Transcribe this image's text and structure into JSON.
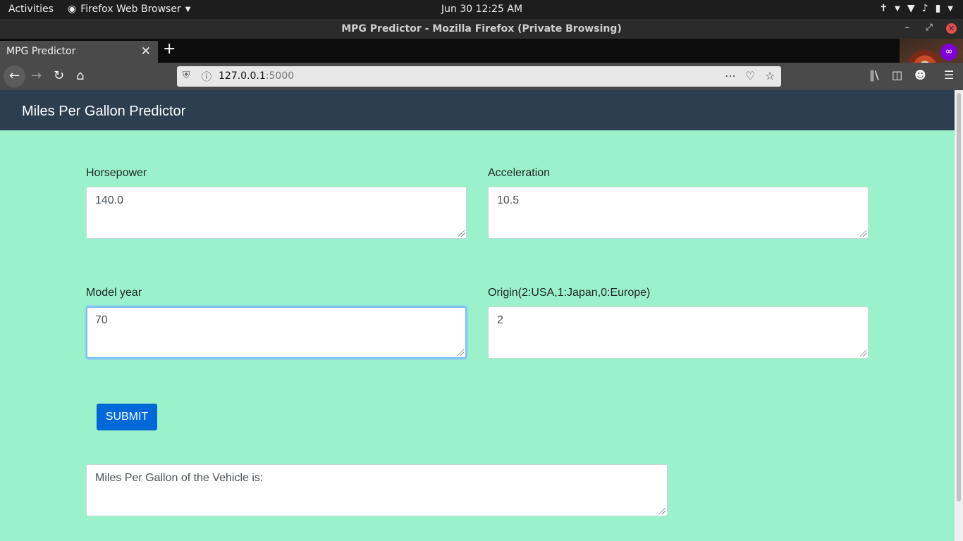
{
  "system_bar": {
    "activities": "Activities",
    "app_menu": "Firefox Web Browser",
    "clock": "Jun 30  12:25 AM"
  },
  "window": {
    "title": "MPG Predictor - Mozilla Firefox (Private Browsing)"
  },
  "tabs": [
    {
      "label": "MPG Predictor"
    }
  ],
  "address_bar": {
    "host": "127.0.0.1",
    "port": ":5000"
  },
  "page": {
    "brand": "Miles Per Gallon Predictor",
    "fields": {
      "horsepower": {
        "label": "Horsepower",
        "value": "140.0"
      },
      "acceleration": {
        "label": "Acceleration",
        "value": "10.5"
      },
      "model_year": {
        "label": "Model year",
        "value": "70"
      },
      "origin": {
        "label": "Origin(2:USA,1:Japan,0:Europe)",
        "value": "2"
      }
    },
    "submit_label": "SUBMIT",
    "result_text": "Miles Per Gallon of the Vehicle is:"
  },
  "colors": {
    "page_bg": "#9bf2ca",
    "header_bg": "#2c3e50",
    "button_bg": "#0069d9",
    "private_badge": "#8000d7"
  },
  "icons": [
    "firefox-icon",
    "accessibility-icon",
    "wifi-icon",
    "volume-icon",
    "battery-icon",
    "back-arrow-icon",
    "forward-arrow-icon",
    "reload-icon",
    "home-icon",
    "shield-icon",
    "info-icon",
    "more-dots-icon",
    "pocket-icon",
    "star-icon",
    "library-icon",
    "sidebar-icon",
    "account-icon",
    "hamburger-menu-icon",
    "private-mask-icon"
  ]
}
